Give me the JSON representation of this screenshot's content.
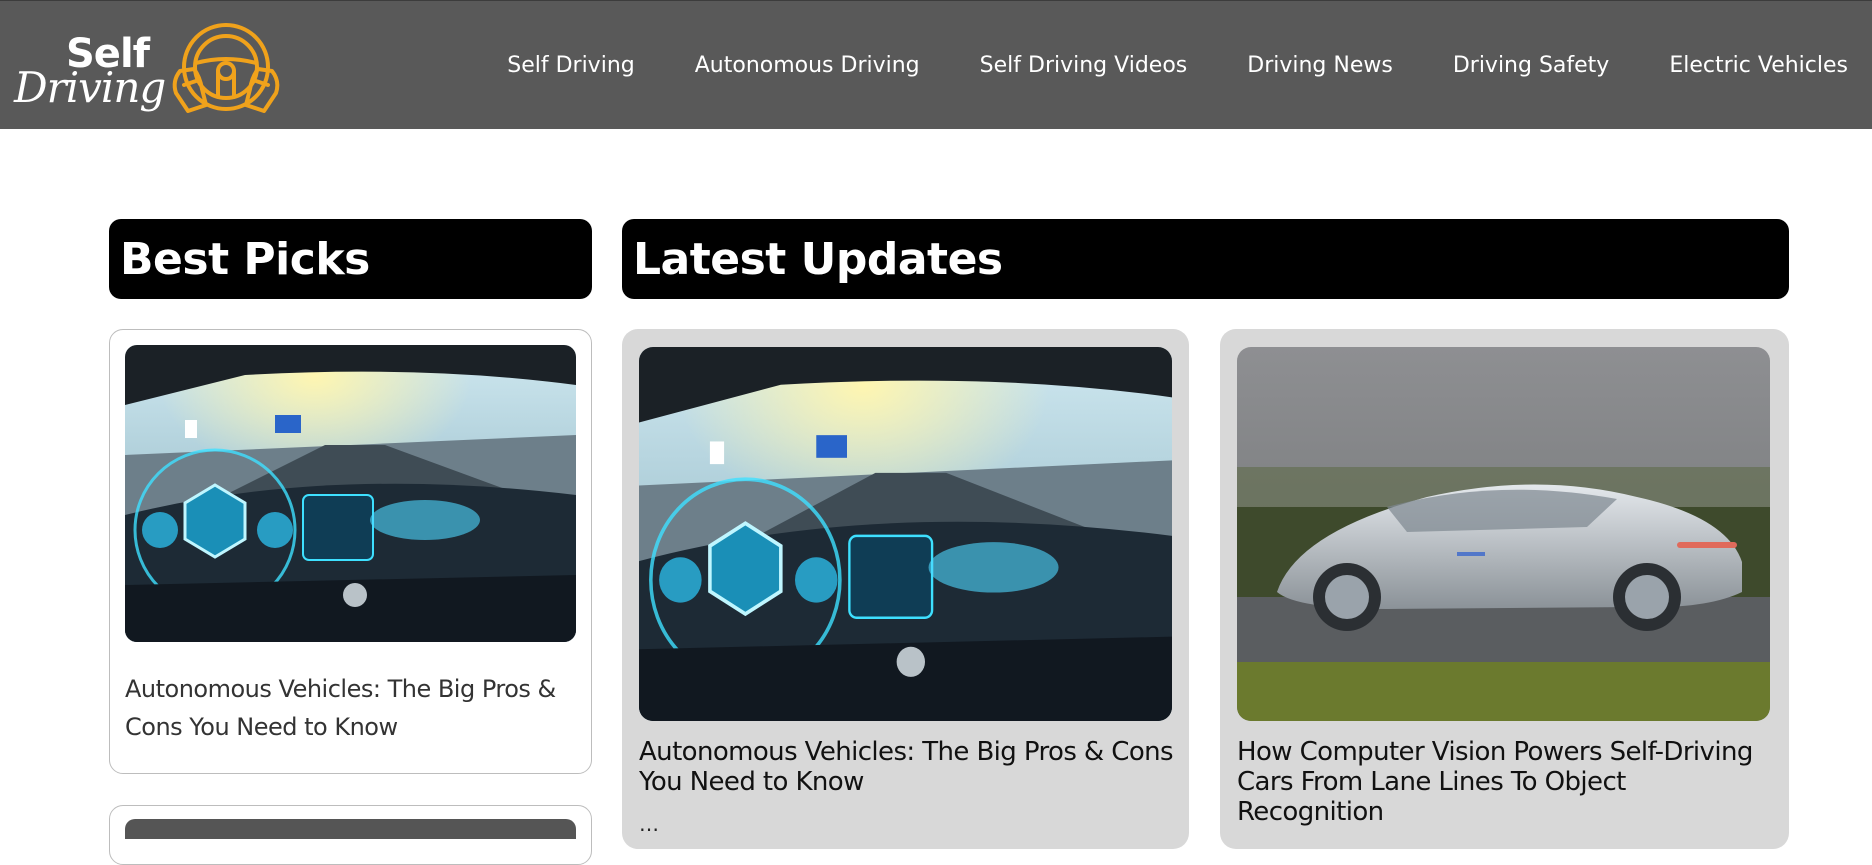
{
  "brand": {
    "line1": "Self",
    "line2": "Driving",
    "accent": "#f0a21b"
  },
  "nav": [
    "Self Driving",
    "Autonomous Driving",
    "Self Driving Videos",
    "Driving News",
    "Driving Safety",
    "Electric Vehicles"
  ],
  "best_picks": {
    "heading": "Best Picks",
    "cards": [
      {
        "title": "Autonomous Vehicles: The Big Pros & Cons You Need to Know",
        "image": "autonomous-car-hud-interior"
      }
    ]
  },
  "latest_updates": {
    "heading": "Latest Updates",
    "cards": [
      {
        "title": "Autonomous Vehicles: The Big Pros & Cons You Need to Know",
        "image": "autonomous-car-hud-interior",
        "excerpt": "…"
      },
      {
        "title": "How Computer Vision Powers Self-Driving Cars From Lane Lines To Object Recognition",
        "image": "silver-concept-car-highway"
      }
    ]
  },
  "colors": {
    "header_bg": "#595959",
    "section_bar": "#000000",
    "card_bg": "#d8d8d8"
  }
}
